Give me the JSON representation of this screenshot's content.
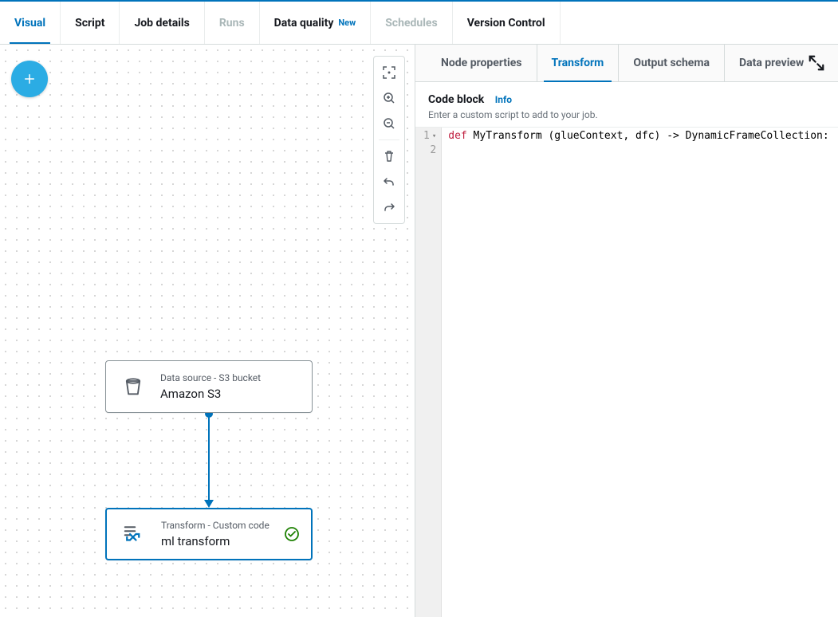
{
  "topTabs": {
    "visual": "Visual",
    "script": "Script",
    "jobDetails": "Job details",
    "runs": "Runs",
    "dataQuality": "Data quality",
    "dataQualityBadge": "New",
    "schedules": "Schedules",
    "versionControl": "Version Control"
  },
  "nodes": {
    "source": {
      "type": "Data source - S3 bucket",
      "title": "Amazon S3"
    },
    "transform": {
      "type": "Transform - Custom code",
      "title": "ml transform"
    }
  },
  "detailTabs": {
    "nodeProps": "Node properties",
    "transform": "Transform",
    "outputSchema": "Output schema",
    "dataPreview": "Data preview"
  },
  "codeSection": {
    "heading": "Code block",
    "info": "Info",
    "sub": "Enter a custom script to add to your job."
  },
  "editor": {
    "lines": {
      "n1": "1",
      "n2": "2"
    },
    "code1": {
      "defKw": "def",
      "name": " MyTransform ",
      "params": "(glueContext, dfc) -> DynamicFrameCollection:"
    }
  }
}
